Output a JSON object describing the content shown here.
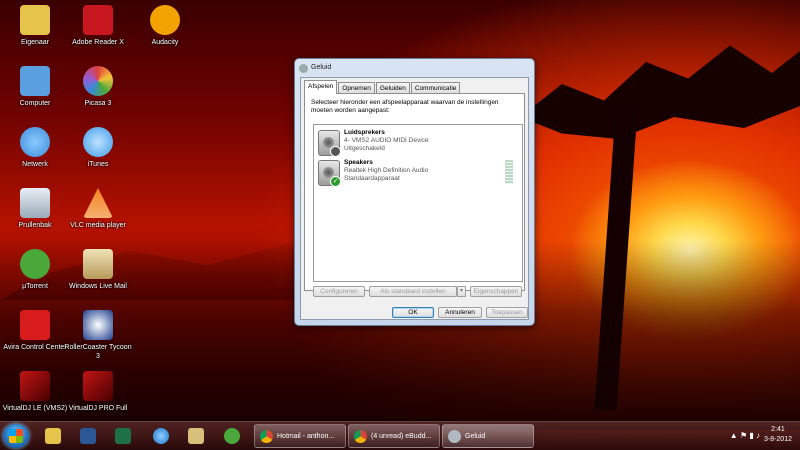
{
  "desktop": {
    "icons": [
      {
        "label": "Eigenaar",
        "icon": "user-folder-icon",
        "color": "#e6c34a"
      },
      {
        "label": "Adobe Reader X",
        "icon": "adobe-reader-icon",
        "color": "#c8171e"
      },
      {
        "label": "Audacity",
        "icon": "audacity-icon",
        "color": "#f2a300"
      },
      {
        "label": "Computer",
        "icon": "computer-icon",
        "color": "#5aa0e0"
      },
      {
        "label": "Picasa 3",
        "icon": "picasa-icon",
        "color": "#9b59d0"
      },
      {
        "label": "Netwerk",
        "icon": "network-icon",
        "color": "#3a8bd8"
      },
      {
        "label": "iTunes",
        "icon": "itunes-icon",
        "color": "#3b9be8"
      },
      {
        "label": "Prullenbak",
        "icon": "recycle-bin-icon",
        "color": "#b9c6d2"
      },
      {
        "label": "VLC media player",
        "icon": "vlc-icon",
        "color": "#f58220"
      },
      {
        "label": "µTorrent",
        "icon": "utorrent-icon",
        "color": "#4aa83a"
      },
      {
        "label": "Windows Live Mail",
        "icon": "windows-live-mail-icon",
        "color": "#c9b98a"
      },
      {
        "label": "Avira Control Center",
        "icon": "avira-icon",
        "color": "#d81b1b"
      },
      {
        "label": "RollerCoaster Tycoon 3",
        "icon": "rollercoaster-tycoon-icon",
        "color": "#1c3d8c"
      },
      {
        "label": "VirtualDJ LE (VMS2)",
        "icon": "virtualdj-icon",
        "color": "#c31414"
      },
      {
        "label": "VirtualDJ PRO Full",
        "icon": "virtualdj-pro-icon",
        "color": "#c31414"
      }
    ]
  },
  "dialog": {
    "title": "Geluid",
    "tabs": [
      "Afspelen",
      "Opnemen",
      "Geluiden",
      "Communicatie"
    ],
    "active_tab": "Afspelen",
    "instruction": "Selecteer hieronder een afspeelapparaat waarvan de instellingen moeten worden aangepast:",
    "devices": [
      {
        "name": "Luidsprekers",
        "driver": "4- VMS2 AUDIO MIDI Device",
        "status": "Uitgeschakeld",
        "state": "disabled"
      },
      {
        "name": "Speakers",
        "driver": "Realtek High Definition Audio",
        "status": "Standaardapparaat",
        "state": "default"
      }
    ],
    "buttons": {
      "configure": "Configureren",
      "set_default": "Als standaard instellen",
      "properties": "Eigenschappen",
      "ok": "OK",
      "cancel": "Annuleren",
      "apply": "Toepassen"
    }
  },
  "taskbar": {
    "tasks": [
      {
        "label": "Hotmail - anthon...",
        "icon": "chrome-icon"
      },
      {
        "label": "(4 unread) eBudd...",
        "icon": "chrome-icon"
      },
      {
        "label": "Geluid",
        "icon": "sound-icon"
      }
    ],
    "time": "2:41",
    "date": "3-8-2012"
  }
}
